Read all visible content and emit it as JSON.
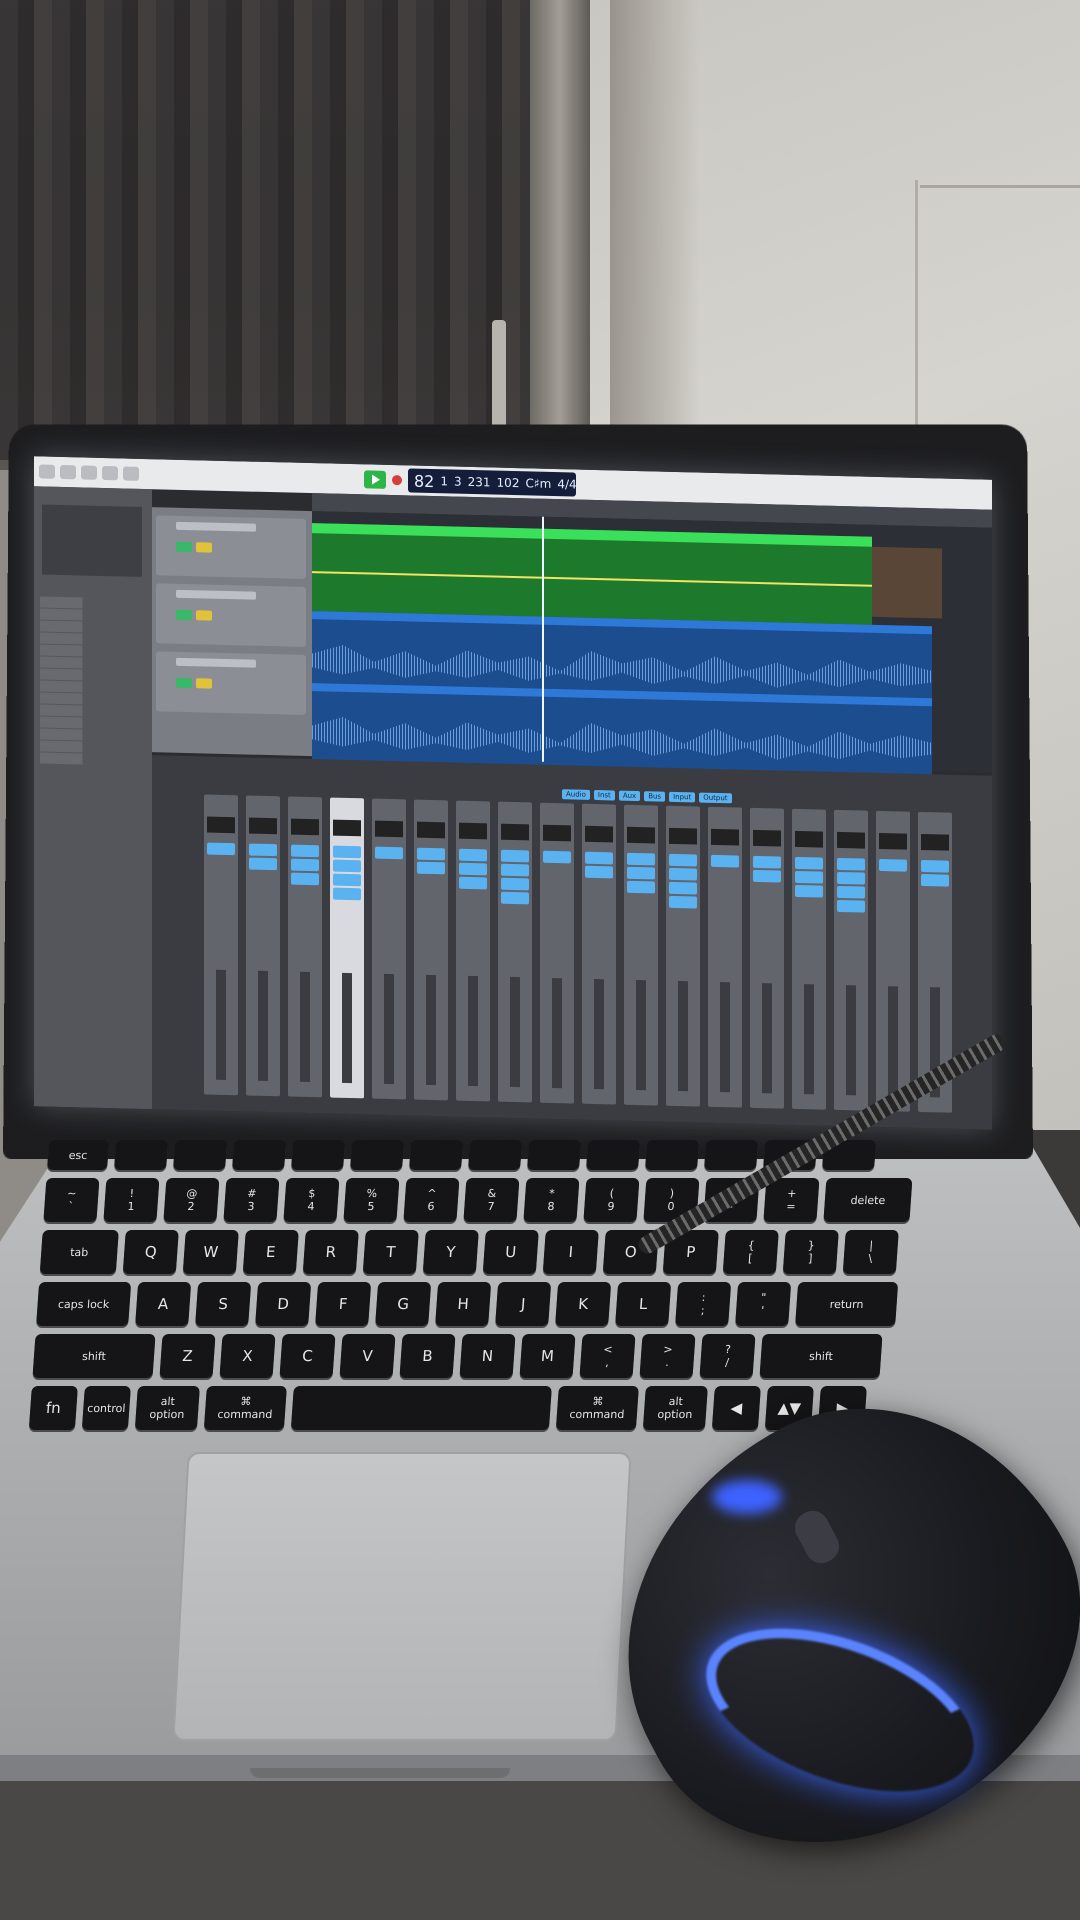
{
  "scene": {
    "laptop_keys": {
      "fn_row": [
        "esc",
        "",
        "",
        "",
        "",
        "",
        "",
        "",
        "",
        "",
        "",
        "",
        "",
        ""
      ],
      "number_row": [
        "~\n`",
        "!\n1",
        "@\n2",
        "#\n3",
        "$\n4",
        "%\n5",
        "^\n6",
        "&\n7",
        "*\n8",
        "(\n9",
        ")\n0",
        "_\n-",
        "+\n=",
        "delete"
      ],
      "top_row": [
        "tab",
        "Q",
        "W",
        "E",
        "R",
        "T",
        "Y",
        "U",
        "I",
        "O",
        "P",
        "{\n[",
        "}\n]",
        "|\n\\"
      ],
      "home_row": [
        "caps lock",
        "A",
        "S",
        "D",
        "F",
        "G",
        "H",
        "J",
        "K",
        "L",
        ":\n;",
        "\"\n'",
        "return"
      ],
      "bottom_row": [
        "shift",
        "Z",
        "X",
        "C",
        "V",
        "B",
        "N",
        "M",
        "<\n,",
        ">\n.",
        "?\n/",
        "shift"
      ],
      "modifier_row": [
        "fn",
        "control",
        "alt\noption",
        "⌘\ncommand",
        "",
        "⌘\ncommand",
        "alt\noption",
        "◀",
        "▲▼",
        "▶"
      ]
    },
    "daw": {
      "transport": {
        "bars": "82",
        "beat": "1",
        "division": "3",
        "tick": "231",
        "tempo": "102",
        "key": "C♯m",
        "signature": "4/4"
      },
      "mixer_tabs": [
        "Audio",
        "Inst",
        "Aux",
        "Bus",
        "Input",
        "Output"
      ],
      "accent_green": "#3ae05a",
      "accent_blue": "#2e78d8",
      "playhead_color": "#eef6ff"
    }
  }
}
